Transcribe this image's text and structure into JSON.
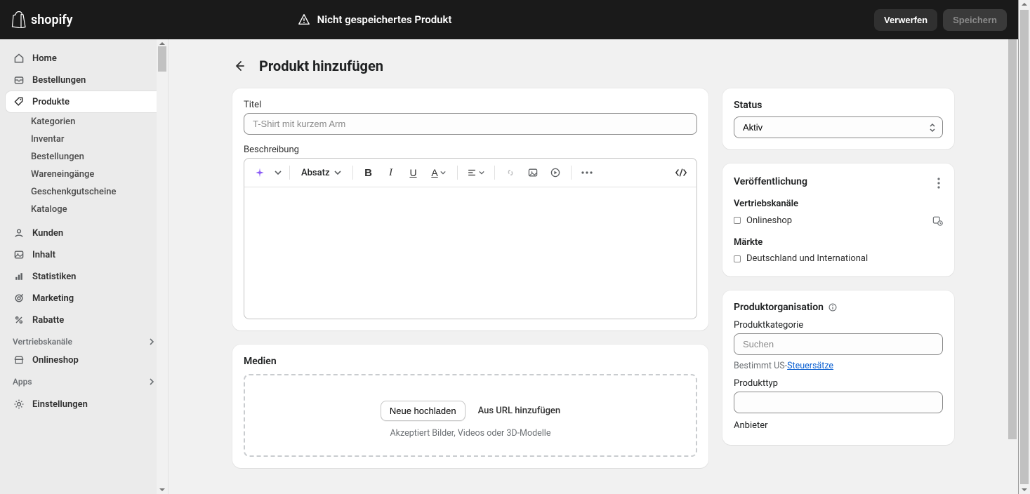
{
  "topbar": {
    "brand": "shopify",
    "unsaved": "Nicht gespeichertes Produkt",
    "discard": "Verwerfen",
    "save": "Speichern"
  },
  "nav": {
    "home": "Home",
    "orders": "Bestellungen",
    "products": "Produkte",
    "products_sub": {
      "categories": "Kategorien",
      "inventory": "Inventar",
      "orders": "Bestellungen",
      "incoming": "Wareneingänge",
      "giftcards": "Geschenkgutscheine",
      "catalogs": "Kataloge"
    },
    "customers": "Kunden",
    "content": "Inhalt",
    "analytics": "Statistiken",
    "marketing": "Marketing",
    "discounts": "Rabatte",
    "channels_label": "Vertriebskanäle",
    "onlinestore": "Onlineshop",
    "apps_label": "Apps",
    "settings": "Einstellungen"
  },
  "page": {
    "title": "Produkt hinzufügen",
    "title_label": "Titel",
    "title_placeholder": "T-Shirt mit kurzem Arm",
    "desc_label": "Beschreibung",
    "paragraph": "Absatz",
    "media_label": "Medien",
    "upload_btn": "Neue hochladen",
    "from_url": "Aus URL hinzufügen",
    "media_help": "Akzeptiert Bilder, Videos oder 3D-Modelle"
  },
  "side": {
    "status_label": "Status",
    "status_value": "Aktiv",
    "publishing": "Veröffentlichung",
    "channels": "Vertriebskanäle",
    "onlinestore": "Onlineshop",
    "markets": "Märkte",
    "market1": "Deutschland und International",
    "org_title": "Produktorganisation",
    "category_label": "Produktkategorie",
    "category_placeholder": "Suchen",
    "tax_prefix": "Bestimmt US-",
    "tax_link": "Steuersätze",
    "type_label": "Produkttyp",
    "vendor_label": "Anbieter"
  }
}
